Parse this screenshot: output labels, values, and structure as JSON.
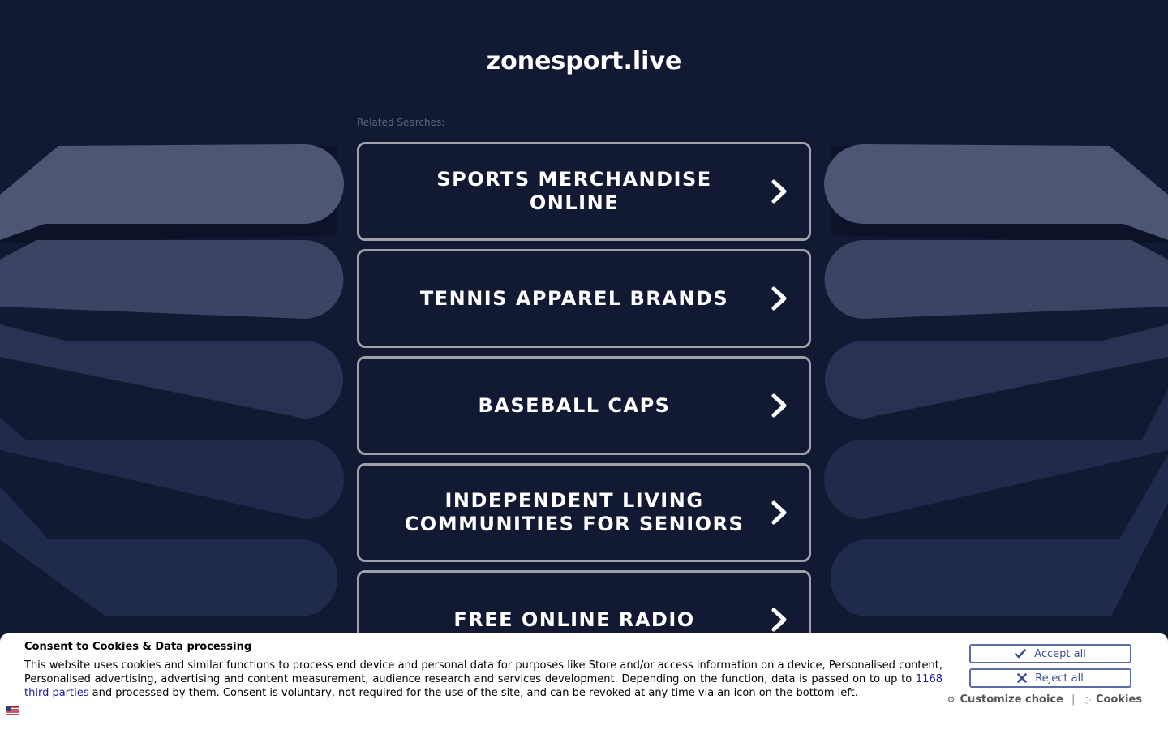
{
  "site": {
    "title": "zonesport.live"
  },
  "related": {
    "label": "Related Searches:",
    "items": [
      {
        "label": "SPORTS MERCHANDISE ONLINE"
      },
      {
        "label": "TENNIS APPAREL BRANDS"
      },
      {
        "label": "BASEBALL CAPS"
      },
      {
        "label": "INDEPENDENT LIVING COMMUNITIES FOR SENIORS"
      },
      {
        "label": "FREE ONLINE RADIO"
      }
    ]
  },
  "consent": {
    "title": "Consent to Cookies & Data processing",
    "text_before": "This website uses cookies and similar functions to process end device and personal data for purposes like Store and/or access information on a device, Personalised content, Personalised advertising, advertising and content measurement, audience research and services development. Depending on the function, data is passed on to up to ",
    "third_parties_link": "1168 third parties",
    "text_after": " and processed by them. Consent is voluntary, not required for the use of the site, and can be revoked at any time via an icon on the bottom left.",
    "accept_label": "Accept all",
    "reject_label": "Reject all",
    "customize_label": "Customize choice",
    "separator": "|",
    "cookies_label": "Cookies"
  },
  "colors": {
    "background": "#121a33",
    "band_light": "#4d5773",
    "band_dark": "#1d2747",
    "accent_blue": "#3d4f95"
  }
}
